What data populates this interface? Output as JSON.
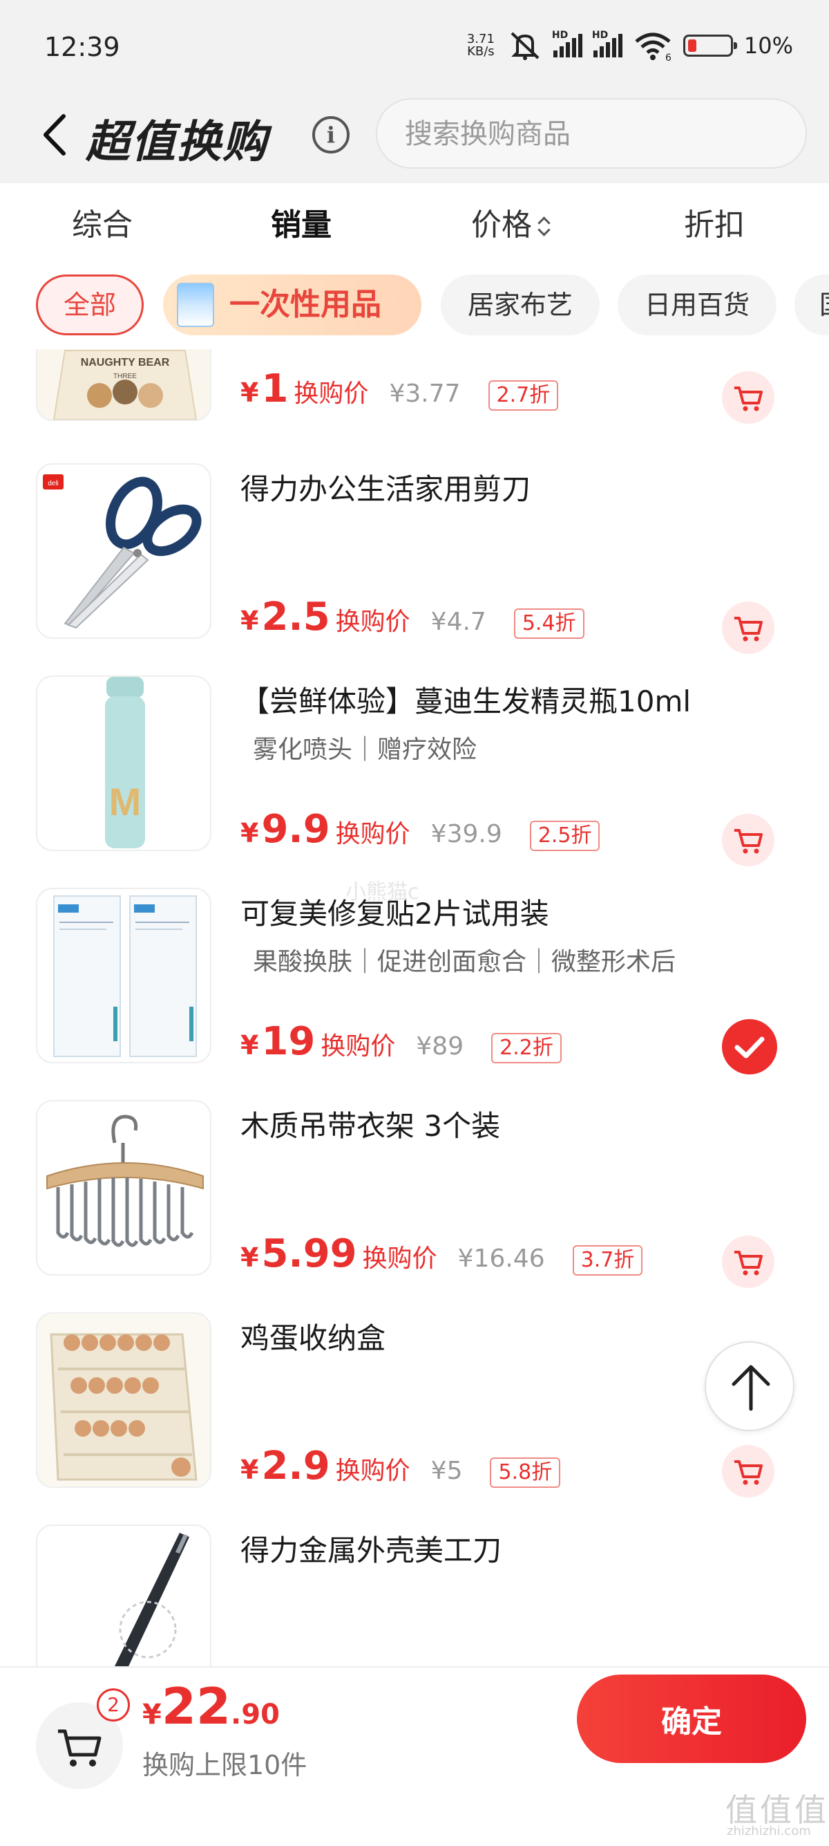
{
  "status_bar": {
    "time": "12:39",
    "speed_top": "3.71",
    "speed_bottom": "KB/s",
    "hd": "HD",
    "wifi_level": "6",
    "battery": "10%"
  },
  "header": {
    "title": "超值换购",
    "info_icon": "i",
    "search_placeholder": "搜索换购商品"
  },
  "sort_tabs": [
    "综合",
    "销量",
    "价格",
    "折扣"
  ],
  "active_sort": "销量",
  "categories": [
    "全部",
    "一次性用品",
    "居家布艺",
    "日用百货",
    "国"
  ],
  "active_category": "全部",
  "products": [
    {
      "name": "",
      "tags": "",
      "price": "1",
      "price_label": "换购价",
      "original": "¥3.77",
      "discount": "2.7折",
      "selected": false
    },
    {
      "name": "得力办公生活家用剪刀",
      "tags": "",
      "price": "2.5",
      "price_label": "换购价",
      "original": "¥4.7",
      "discount": "5.4折",
      "selected": false
    },
    {
      "name": "【尝鲜体验】蔓迪生发精灵瓶10ml",
      "tags": "雾化喷头｜赠疗效险",
      "price": "9.9",
      "price_label": "换购价",
      "original": "¥39.9",
      "discount": "2.5折",
      "selected": false
    },
    {
      "name": "可复美修复贴2片试用装",
      "tags": "果酸换肤｜促进创面愈合｜微整形术后",
      "price": "19",
      "price_label": "换购价",
      "original": "¥89",
      "discount": "2.2折",
      "selected": true
    },
    {
      "name": "木质吊带衣架 3个装",
      "tags": "",
      "price": "5.99",
      "price_label": "换购价",
      "original": "¥16.46",
      "discount": "3.7折",
      "selected": false
    },
    {
      "name": "鸡蛋收纳盒",
      "tags": "",
      "price": "2.9",
      "price_label": "换购价",
      "original": "¥5",
      "discount": "5.8折",
      "selected": false
    },
    {
      "name": "得力金属外壳美工刀",
      "tags": "",
      "price": "",
      "price_label": "",
      "original": "",
      "discount": "",
      "selected": false
    }
  ],
  "currency": "¥",
  "thumb_text": {
    "bag_top": "NAUGHTY BEAR",
    "bag_sub": "THREE",
    "deli": "deli"
  },
  "watermark_mid": "小熊猫c",
  "bottom": {
    "cart_count": "2",
    "currency": "¥",
    "total_int": "22",
    "total_dec": ".90",
    "limit": "换购上限10件",
    "confirm": "确定"
  },
  "watermark": {
    "logo": "值值值",
    "url": "zhizhizhi.com"
  },
  "colors": {
    "accent": "#e8312f",
    "chip_active_bg": "#fff0ef",
    "cart_bg": "#ffe9e8"
  }
}
